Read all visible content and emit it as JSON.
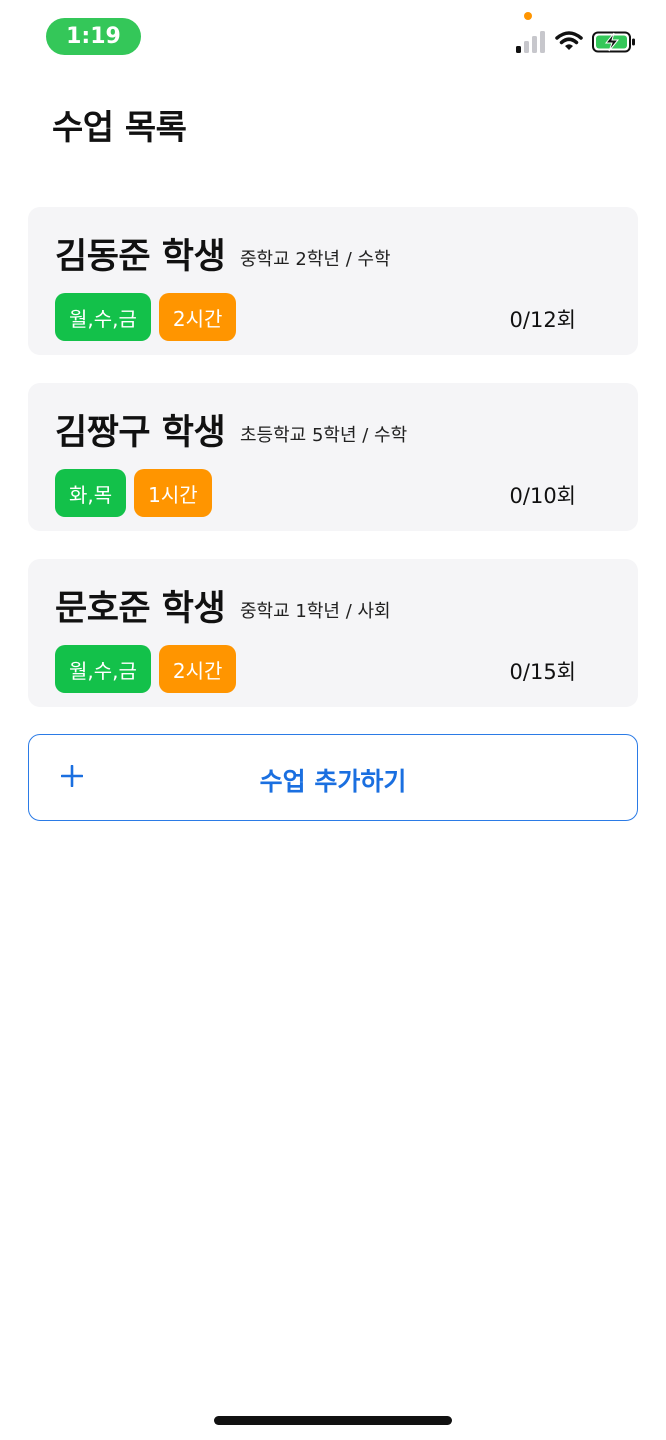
{
  "status_bar": {
    "time": "1:19",
    "icons": [
      "signal-icon",
      "wifi-icon",
      "battery-charging-icon"
    ],
    "time_pill_color": "#34c759",
    "privacy_dot_color": "#ff9500"
  },
  "header": {
    "title": "수업 목록"
  },
  "lessons": [
    {
      "name": "김동준 학생",
      "info": "중학교 2학년 / 수학",
      "days": "월,수,금",
      "hours": "2시간",
      "count": "0/12회"
    },
    {
      "name": "김짱구 학생",
      "info": "초등학교 5학년 / 수학",
      "days": "화,목",
      "hours": "1시간",
      "count": "0/10회"
    },
    {
      "name": "문호준 학생",
      "info": "중학교 1학년 / 사회",
      "days": "월,수,금",
      "hours": "2시간",
      "count": "0/15회"
    }
  ],
  "add_button": {
    "icon": "plus-icon",
    "label": "수업 추가하기"
  },
  "colors": {
    "days_tag": "#13c14a",
    "hours_tag": "#ff9500",
    "accent": "#1a6fe0",
    "card_background": "#f5f5f7"
  }
}
